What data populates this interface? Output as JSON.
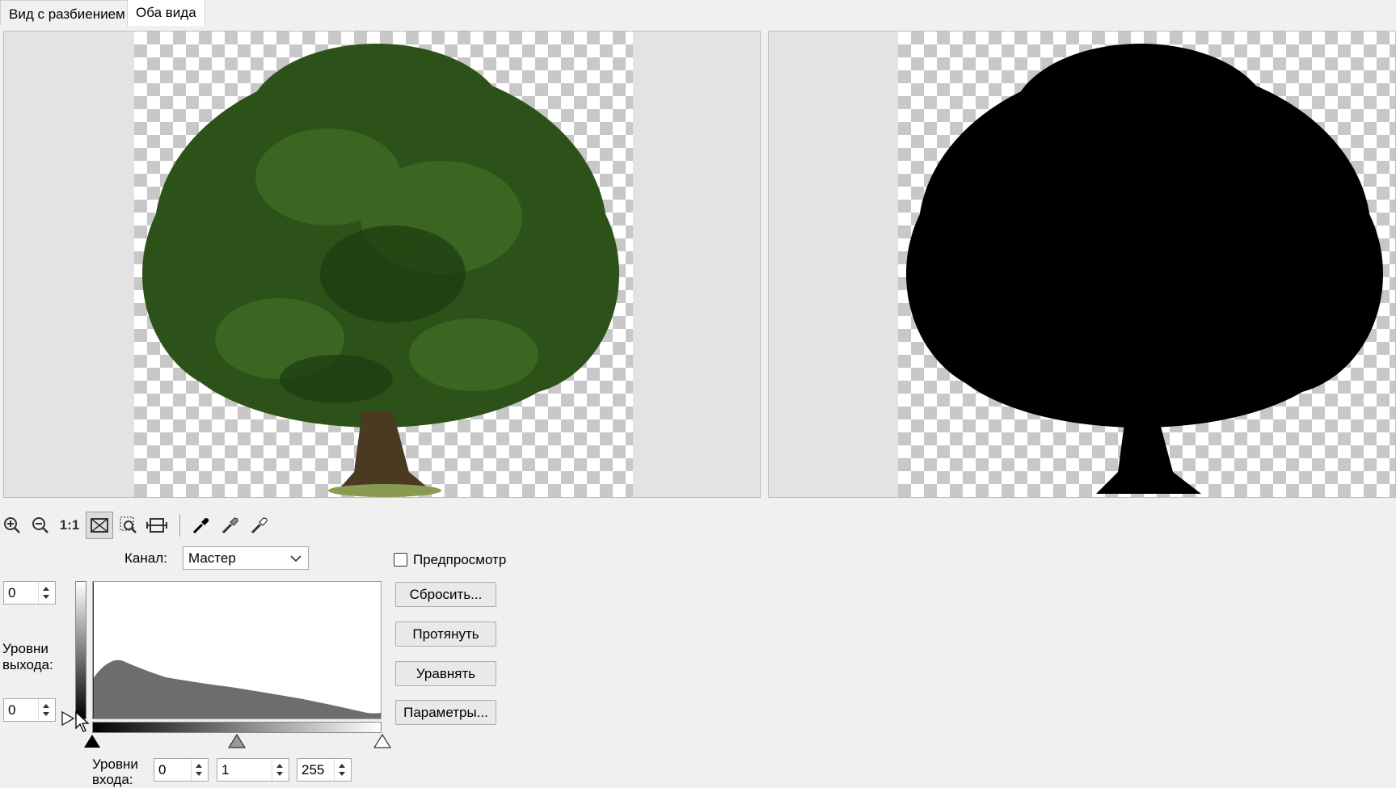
{
  "tabs": [
    {
      "label": "Вид с разбиением",
      "active": false
    },
    {
      "label": "Оба вида",
      "active": true
    }
  ],
  "colors": {
    "foliage": "#2d5219",
    "silhouette": "#000000",
    "histogram": "#6d6d6d"
  },
  "toolbar": {
    "icons": [
      "zoom-in-icon",
      "zoom-out-icon",
      "actual-size-icon",
      "fit-to-window-icon",
      "zoom-region-icon",
      "fit-width-icon",
      "black-eyedropper-icon",
      "gray-eyedropper-icon",
      "white-eyedropper-icon"
    ],
    "actual_size_label": "1:1"
  },
  "channel": {
    "label": "Канал:",
    "value": "Мастер"
  },
  "preview": {
    "label": "Предпросмотр",
    "checked": false
  },
  "buttons": {
    "reset": "Сбросить...",
    "stretch": "Протянуть",
    "equalize": "Уравнять",
    "params": "Параметры..."
  },
  "output_levels": {
    "label_line1": "Уровни",
    "label_line2": "выхода:",
    "top_value": "0",
    "bottom_value": "0"
  },
  "input_levels": {
    "label_line1": "Уровни",
    "label_line2": "входа:",
    "black": "0",
    "gamma": "1",
    "white": "255"
  }
}
